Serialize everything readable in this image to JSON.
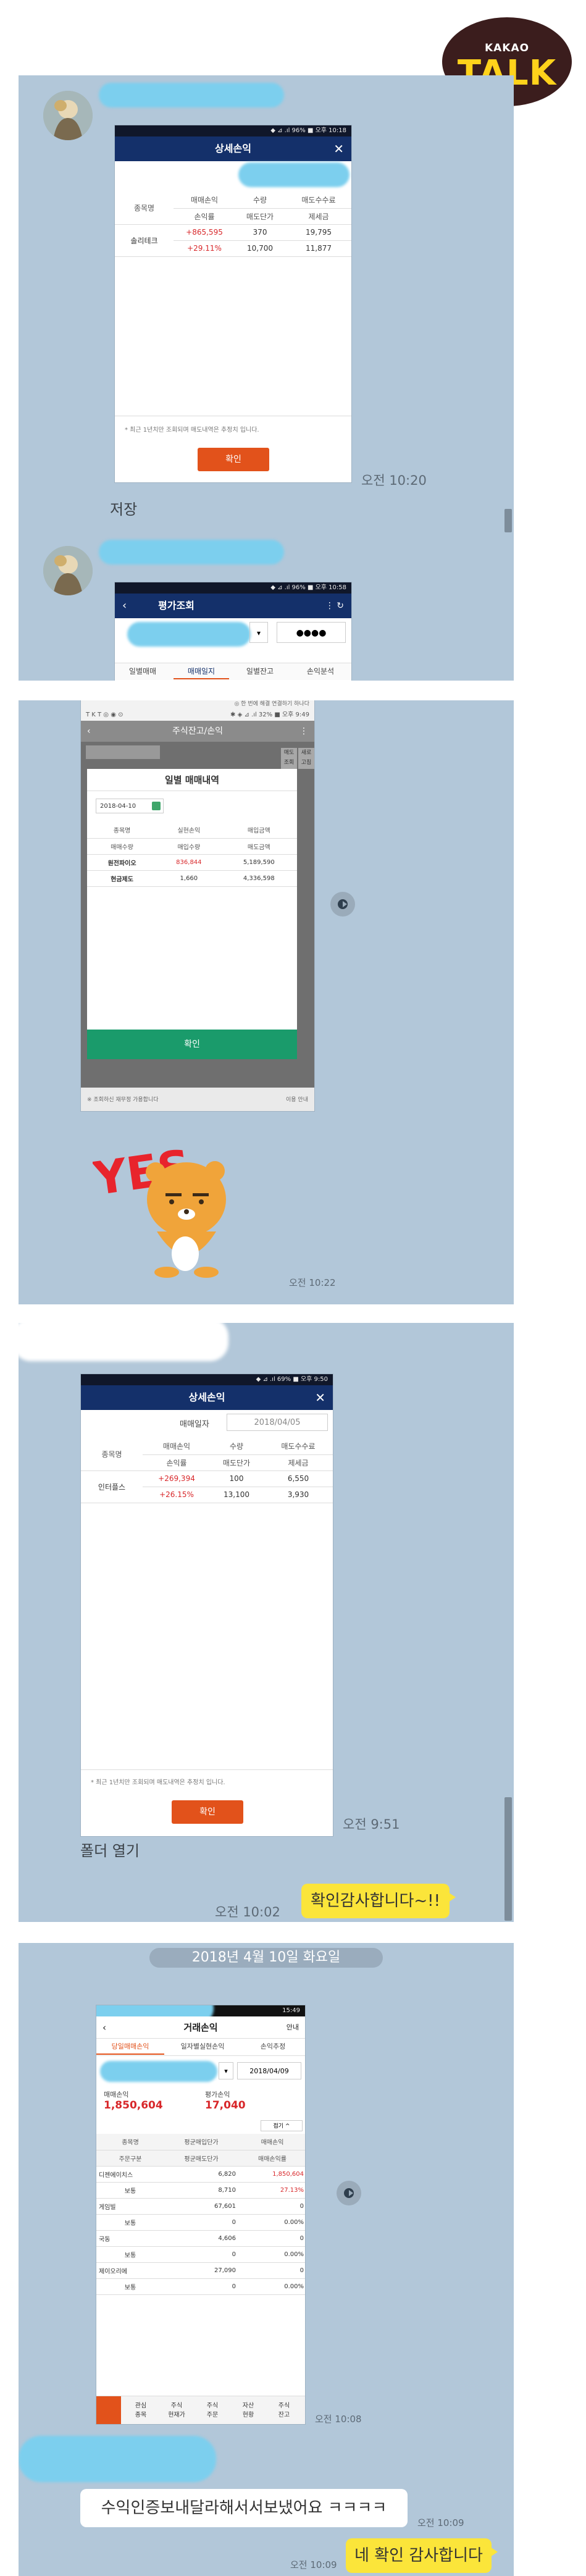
{
  "badge": {
    "kakao": "KAKAO",
    "talk": "TALK"
  },
  "panel1": {
    "statusbar": "◆ ⊿ .ıl 96% ■ 오후 10:18",
    "title": "상세손익",
    "col1": {
      "h1": "종목명",
      "h2": ""
    },
    "col2": {
      "h1": "매매손익",
      "h2": "손익률"
    },
    "col3": {
      "h1": "수량",
      "h2": "매도단가"
    },
    "col4": {
      "h1": "매도수수료",
      "h2": "제세금"
    },
    "row": {
      "name": "솔리테크",
      "pnl": "+865,595",
      "rate": "+29.11%",
      "qty": "370",
      "price": "10,700",
      "fee": "19,795",
      "tax": "11,877"
    },
    "note": "* 최근 1년치만 조회되며 매도내역은 추정치 입니다.",
    "ok": "확인",
    "time": "오전 10:20",
    "caption": "저장",
    "statusbar2": "◆ ⊿ .ıl 96% ■ 오후 10:58",
    "title2": "평가조회",
    "pin": "●●●●",
    "tabs": [
      "일별매매",
      "매매일지",
      "일별잔고",
      "손익분석"
    ]
  },
  "panel2": {
    "statusbar_left": "T K T ◎ ◉ ⊙",
    "statusbar": "✱ ◈ ⊿ .ıl 32% ■ 오후 9:49",
    "top_hint": "◎ 한 번에 해결 연결하기 하나다",
    "title": "주식잔고/손익",
    "side_btn1": "매도",
    "side_btn2": "조회",
    "side_btn3": "새로",
    "side_btn4": "고침",
    "modal_title": "일별 매매내역",
    "date_value": "2018-04-10",
    "hdr": {
      "a": "종목명",
      "b": "실현손익",
      "c": "매입금액",
      "d": "매매수량",
      "e": "매입수량",
      "f": "매도금액"
    },
    "rows": [
      {
        "name": "원전파이오",
        "pnl": "836,844",
        "buy": "5,189,590"
      },
      {
        "name": "현금제도",
        "pnl": "1,660",
        "buy": "4,336,598"
      }
    ],
    "ok": "확인",
    "footer": "※ 조회하신 재무정 가용합니다",
    "footer_right": "이용 안내",
    "sticker_word": "YES",
    "time": "오전 10:22"
  },
  "panel3": {
    "statusbar": "◆ ⊿ .ıl 69% ■ 오후 9:50",
    "title": "상세손익",
    "date_label": "매매일자",
    "date_value": "2018/04/05",
    "col1": {
      "h1": "종목명"
    },
    "col2": {
      "h1": "매매손익",
      "h2": "손익률"
    },
    "col3": {
      "h1": "수량",
      "h2": "매도단가"
    },
    "col4": {
      "h1": "매도수수료",
      "h2": "제세금"
    },
    "row": {
      "name": "인터플스",
      "pnl": "+269,394",
      "rate": "+26.15%",
      "qty": "100",
      "price": "13,100",
      "fee": "6,550",
      "tax": "3,930"
    },
    "note": "* 최근 1년치만 조회되며 매도내역은 추정치 입니다.",
    "ok": "확인",
    "time1": "오전 9:51",
    "caption": "폴더 열기",
    "time2": "오전 10:02",
    "bubble": "확인감사합니다~!!"
  },
  "panel4": {
    "date": "2018년 4월 10일 화요일",
    "clock": "15:49",
    "title": "거래손익",
    "guide": "안내",
    "tabs": [
      "당일매매손익",
      "일자별실현손익",
      "손익추정"
    ],
    "date_select": "2018/04/09",
    "sum_label1": "매매손익",
    "sum_value1": "1,850,604",
    "sum_label2": "평가손익",
    "sum_value2": "17,040",
    "collapse": "접기 ^",
    "hdr": {
      "a1": "종목명",
      "a2": "주문구분",
      "b1": "평균매입단가",
      "b2": "평균매도단가",
      "c1": "매매손익",
      "c2": "매매손익률"
    },
    "rows": [
      {
        "name": "디젠에이치스",
        "kind": "보통",
        "buy": "6,820",
        "sell": "8,710",
        "pnl": "1,850,604",
        "rate": "27.13%"
      },
      {
        "name": "게임빌",
        "kind": "보통",
        "buy": "67,601",
        "sell": "0",
        "pnl": "0",
        "rate": "0.00%"
      },
      {
        "name": "국동",
        "kind": "보통",
        "buy": "4,606",
        "sell": "0",
        "pnl": "0",
        "rate": "0.00%"
      },
      {
        "name": "제이오리에",
        "kind": "보통",
        "buy": "27,090",
        "sell": "0",
        "pnl": "0",
        "rate": "0.00%"
      }
    ],
    "bottom_tabs": [
      {
        "l1": "관심",
        "l2": "종목"
      },
      {
        "l1": "주식",
        "l2": "현재가"
      },
      {
        "l1": "주식",
        "l2": "주문"
      },
      {
        "l1": "자산",
        "l2": "현황"
      },
      {
        "l1": "주식",
        "l2": "잔고"
      }
    ],
    "time1": "오전 10:08",
    "msg": "수익인증보내달라해서서보냈어요 ㅋㅋㅋㅋ",
    "time2": "오전 10:09",
    "time3": "오전 10:09",
    "bubble": "네 확인 감사합니다"
  }
}
